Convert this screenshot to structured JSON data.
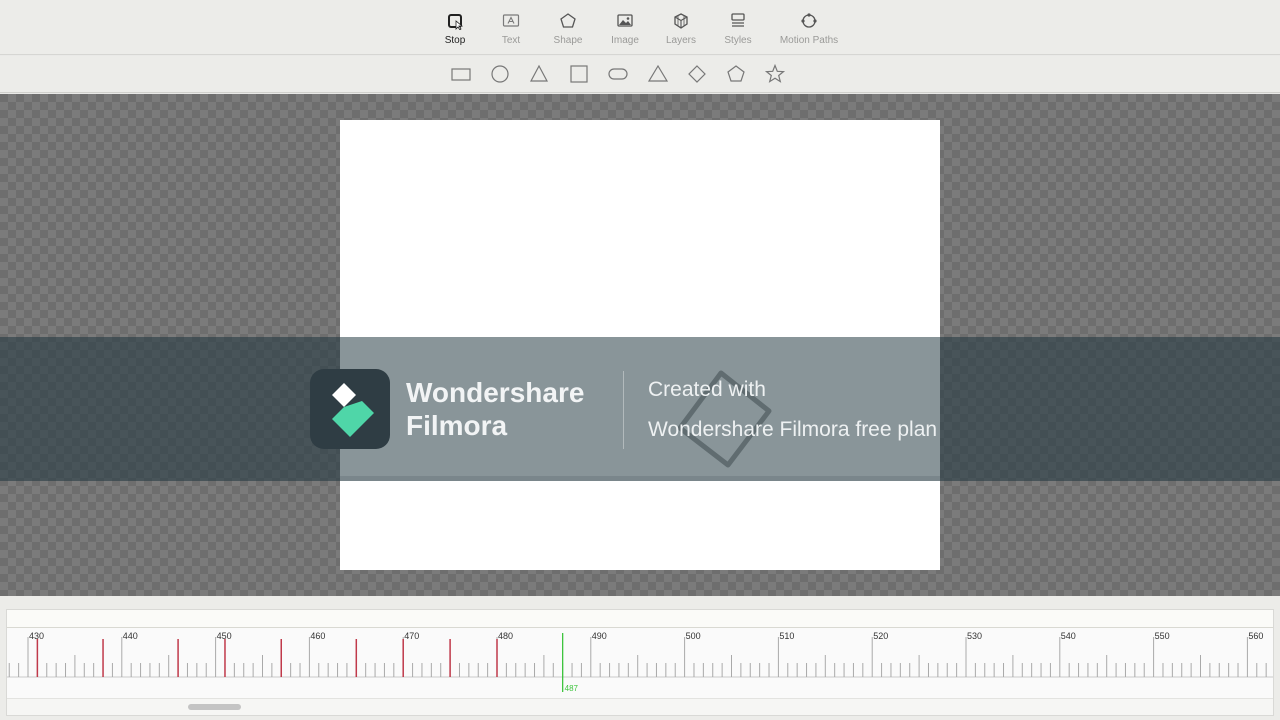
{
  "toolbar": {
    "tools": [
      {
        "label": "Stop",
        "icon": "stop-icon",
        "active": true
      },
      {
        "label": "Text",
        "icon": "text-icon",
        "active": false
      },
      {
        "label": "Shape",
        "icon": "pentagon-icon",
        "active": false
      },
      {
        "label": "Image",
        "icon": "image-icon",
        "active": false
      },
      {
        "label": "Layers",
        "icon": "layers-icon",
        "active": false
      },
      {
        "label": "Styles",
        "icon": "styles-icon",
        "active": false
      },
      {
        "label": "Motion Paths",
        "icon": "motion-path-icon",
        "active": false
      }
    ]
  },
  "shapes": [
    {
      "name": "rectangle",
      "icon": "rectangle-shape-icon"
    },
    {
      "name": "circle",
      "icon": "circle-shape-icon"
    },
    {
      "name": "triangle",
      "icon": "triangle-shape-icon"
    },
    {
      "name": "square",
      "icon": "square-shape-icon"
    },
    {
      "name": "rounded-rect",
      "icon": "rounded-rect-shape-icon"
    },
    {
      "name": "triangle-alt",
      "icon": "triangle-alt-shape-icon"
    },
    {
      "name": "diamond",
      "icon": "diamond-shape-icon"
    },
    {
      "name": "pentagon",
      "icon": "pentagon-shape-icon"
    },
    {
      "name": "star",
      "icon": "star-shape-icon"
    }
  ],
  "watermark": {
    "brand_line1": "Wondershare",
    "brand_line2": "Filmora",
    "created": "Created with",
    "plan": "Wondershare Filmora free plan"
  },
  "timeline": {
    "labels": [
      "430",
      "440",
      "450",
      "460",
      "470",
      "480",
      "490",
      "500",
      "510",
      "520",
      "530",
      "540",
      "550",
      "560"
    ],
    "current_frame": "487",
    "keyframes": [
      431,
      438,
      446,
      451,
      457,
      465,
      470,
      475,
      480
    ],
    "colors": {
      "keyframe": "#c0394a",
      "playhead": "#3ec43e",
      "tick": "#a9a9a9"
    }
  }
}
